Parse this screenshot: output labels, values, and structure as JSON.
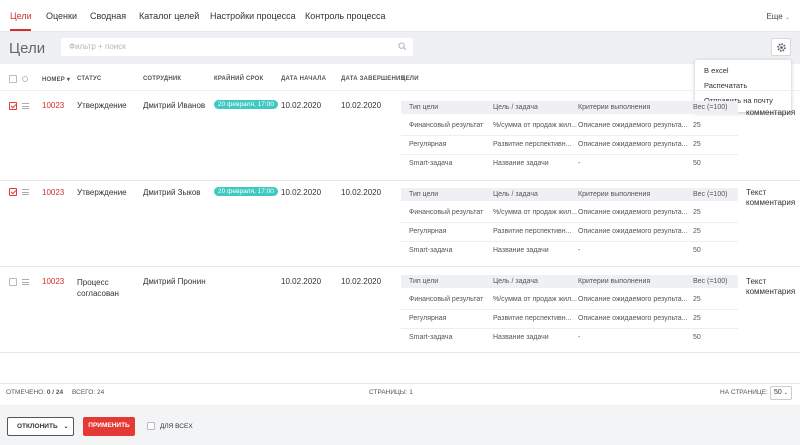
{
  "nav": {
    "tabs": [
      "Цели",
      "Оценки",
      "Сводная",
      "Каталог целей",
      "Настройки процесса",
      "Контроль процесса"
    ],
    "more": "Еще"
  },
  "header": {
    "title": "Цели",
    "search_placeholder": "Фильтр + поиск"
  },
  "dropdown": [
    "В excel",
    "Распечатать",
    "Отправить на почту"
  ],
  "columns": [
    "НОМЕР",
    "СТАТУС",
    "СОТРУДНИК",
    "КРАЙНИЙ СРОК",
    "ДАТА НАЧАЛА",
    "ДАТА ЗАВЕРШЕНИЯ",
    "ЦЕЛИ"
  ],
  "subheaders": [
    "Тип цели",
    "Цель / задача",
    "Критерии выполнения",
    "Вес (=100)"
  ],
  "rows": [
    {
      "checked": true,
      "number": "10023",
      "status": "Утверждение",
      "employee": "Дмитрий Иванов",
      "deadline": "20 февраля, 17:00",
      "start": "10.02.2020",
      "end": "10.02.2020",
      "comment_line1": "",
      "comment_line2": "комментария",
      "goals": [
        [
          "Финансовый результат",
          "%/сумма от продаж жил...",
          "Описание ожидаемого результа...",
          "25"
        ],
        [
          "Регулярная",
          "Развитие перспективн...",
          "Описание ожидаемого результа...",
          "25"
        ],
        [
          "Smart-задача",
          "Название задачи",
          "-",
          "50"
        ]
      ]
    },
    {
      "checked": true,
      "number": "10023",
      "status": "Утверждение",
      "employee": "Дмитрий Зыков",
      "deadline": "20 февраля, 17:00",
      "start": "10.02.2020",
      "end": "10.02.2020",
      "comment_line1": "Текст",
      "comment_line2": "комментария",
      "goals": [
        [
          "Финансовый результат",
          "%/сумма от продаж жил...",
          "Описание ожидаемого результа...",
          "25"
        ],
        [
          "Регулярная",
          "Развитие перспективн...",
          "Описание ожидаемого результа...",
          "25"
        ],
        [
          "Smart-задача",
          "Название задачи",
          "-",
          "50"
        ]
      ]
    },
    {
      "checked": false,
      "number": "10023",
      "status_line1": "Процесс",
      "status_line2": "согласован",
      "employee": "Дмитрий Пронин",
      "deadline": "",
      "start": "10.02.2020",
      "end": "10.02.2020",
      "comment_line1": "Текст",
      "comment_line2": "комментария",
      "goals": [
        [
          "Финансовый результат",
          "%/сумма от продаж жил...",
          "Описание ожидаемого результа...",
          "25"
        ],
        [
          "Регулярная",
          "Развитие перспективн...",
          "Описание ожидаемого результа...",
          "25"
        ],
        [
          "Smart-задача",
          "Название задачи",
          "-",
          "50"
        ]
      ]
    }
  ],
  "footer": {
    "marked_label": "ОТМЕЧЕНО:",
    "marked_value": "0 / 24",
    "total": "ВСЕГО: 24",
    "pages": "СТРАНИЦЫ: 1",
    "per_page_label": "НА СТРАНИЦЕ:",
    "per_page_value": "50"
  },
  "actions": {
    "reject": "ОТКЛОНИТЬ",
    "apply": "ПРИМЕНИТЬ",
    "for_all": "ДЛЯ ВСЕХ"
  },
  "colors": {
    "accent": "#d32f2f",
    "badge": "#3fc9c2"
  }
}
